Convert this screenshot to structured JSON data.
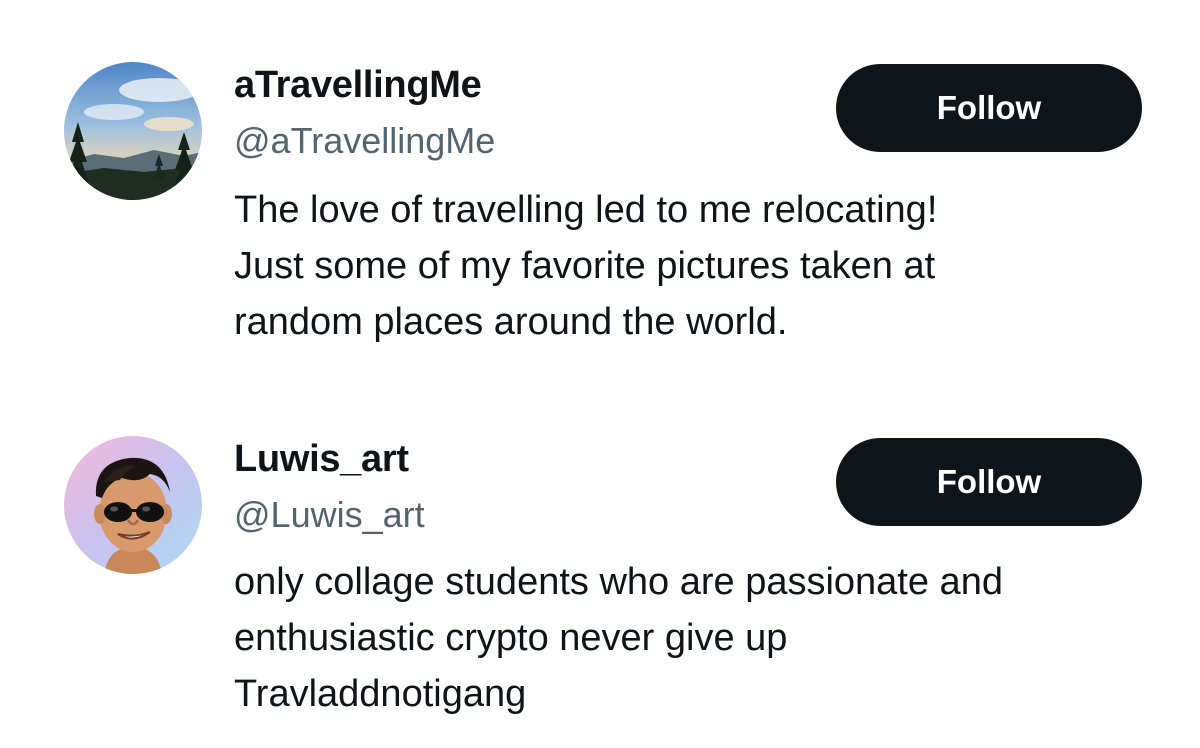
{
  "follow_button_color": "#0f1419",
  "handle_color": "#536471",
  "users": [
    {
      "display_name": "aTravellingMe",
      "handle": "@aTravellingMe",
      "follow_label": "Follow",
      "bio": "The love of travelling led to me relocating!\nJust some of my favorite pictures taken at\nrandom places around the world.",
      "avatar_icon": "landscape-photo-avatar"
    },
    {
      "display_name": "Luwis_art",
      "handle": "@Luwis_art",
      "follow_label": "Follow",
      "bio": "only collage students who are passionate and\nenthusiastic crypto never give up\nTravladdnotigang",
      "avatar_icon": "cartoon-face-avatar"
    }
  ]
}
